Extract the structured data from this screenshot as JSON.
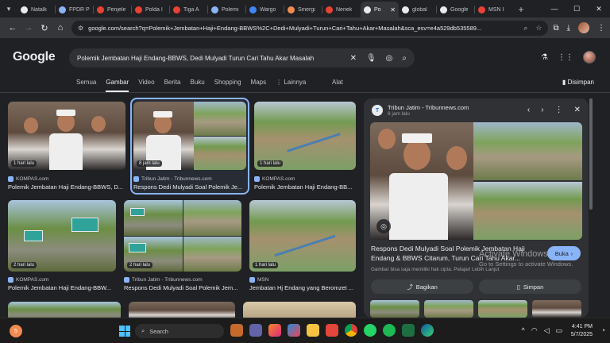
{
  "browser": {
    "tabs": [
      {
        "label": "Natalk",
        "color": "#e8eaed"
      },
      {
        "label": "FPDR P",
        "color": "#8ab4f8"
      },
      {
        "label": "Penjele",
        "color": "#e94235"
      },
      {
        "label": "Polda I",
        "color": "#e94235"
      },
      {
        "label": "Tiga A",
        "color": "#e94235"
      },
      {
        "label": "Polemi",
        "color": "#8ab4f8"
      },
      {
        "label": "Wargo",
        "color": "#4285f4"
      },
      {
        "label": "Sinergi",
        "color": "#f28b50"
      },
      {
        "label": "Nenek",
        "color": "#e94235"
      },
      {
        "label": "Po",
        "color": "#e8eaed"
      },
      {
        "label": "global",
        "color": "#e8eaed"
      },
      {
        "label": "Google",
        "color": "#e8eaed"
      },
      {
        "label": "MSN I",
        "color": "#e94235"
      }
    ],
    "active_tab_close": "✕",
    "new_tab": "+",
    "url": "google.com/search?q=Polemik+Jembatan+Haji+Endang-BBWS%2C+Dedi+Mulyadi+Turun+Cari+Tahu+Akar+Masalah&sca_esv=e4a529db535589..."
  },
  "google": {
    "logo": "Google",
    "query": "Polemik Jembatan Haji Endang-BBWS, Dedi Mulyadi Turun Cari Tahu Akar Masalah",
    "filters": [
      "Semua",
      "Gambar",
      "Video",
      "Berita",
      "Buku",
      "Shopping",
      "Maps",
      "⋮ Lainnya"
    ],
    "active_filter_index": 1,
    "tools": "Alat",
    "saved": "Disimpan"
  },
  "results": [
    {
      "badge": "1 hari lalu",
      "source": "KOMPAS.com",
      "caption": "Polemik Jembatan Haji Endang-BBWS, D..."
    },
    {
      "badge": "8 jam lalu",
      "source": "Tribun Jatim - Tribunnews.com",
      "caption": "Respons Dedi Mulyadi Soal Polemik Je..."
    },
    {
      "badge": "1 hari lalu",
      "source": "KOMPAS.com",
      "caption": "Polemik Jembatan Haji Endang-BB..."
    },
    {
      "badge": "2 hari lalu",
      "source": "KOMPAS.com",
      "caption": "Polemik Jembatan Haji Endang-BBW..."
    },
    {
      "badge": "2 hari lalu",
      "source": "Tribun Jatim - Tribunnews.com",
      "caption": "Respons Dedi Mulyadi Soal Polemik Jem..."
    },
    {
      "badge": "1 hari lalu",
      "source": "MSN",
      "caption": "Jembatan Hj Endang yang Beromzet ..."
    }
  ],
  "preview": {
    "source": "Tribun Jatim - Tribunnews.com",
    "date": "8 jam lalu",
    "title": "Respons Dedi Mulyadi Soal Polemik Jembatan Haji Endang & BBWS Citarum, Turun Cari Tahu Akar...",
    "visit_label": "Buka",
    "note": "Gambar bisa saja memiliki hak cipta. Pelajari Lebih Lanjut",
    "share_label": "Bagikan",
    "save_label": "Simpan"
  },
  "watermark": {
    "line1": "Activate Windows",
    "line2": "Go to Settings to activate Windows."
  },
  "taskbar": {
    "weather_badge": "5",
    "search_placeholder": "Search",
    "time": "4:41 PM",
    "date": "5/7/2025"
  },
  "colors": {
    "accent": "#8ab4f8",
    "background": "#202124",
    "surface": "#303134"
  }
}
